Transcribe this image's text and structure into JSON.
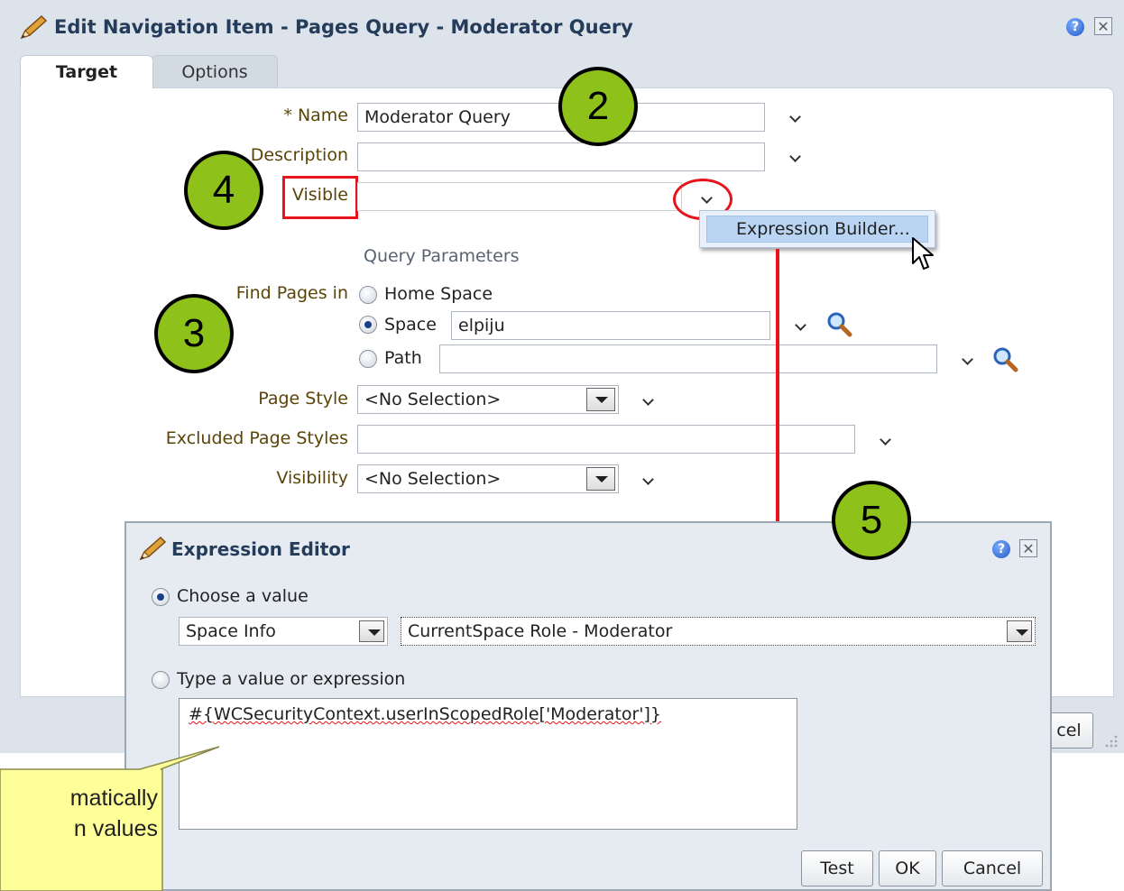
{
  "dialog": {
    "title": "Edit Navigation Item - Pages Query - Moderator Query",
    "help_icon": "?",
    "close_icon": "✕",
    "tabs": [
      {
        "label": "Target",
        "active": true
      },
      {
        "label": "Options",
        "active": false
      }
    ]
  },
  "form": {
    "name_label": "* Name",
    "name_value": "Moderator Query",
    "description_label": "Description",
    "description_value": "",
    "visible_label": "Visible",
    "visible_value": "",
    "query_params_heading": "Query Parameters",
    "find_pages_label": "Find Pages in",
    "radio_home": "Home Space",
    "radio_space": "Space",
    "space_value": "elpiju",
    "radio_path": "Path",
    "path_value": "",
    "page_style_label": "Page Style",
    "page_style_value": "<No Selection>",
    "excluded_label": "Excluded Page Styles",
    "excluded_value": "",
    "visibility_label": "Visibility",
    "visibility_value": "<No Selection>"
  },
  "dropdown_menu": {
    "item": "Expression Builder..."
  },
  "bottom_buttons": {
    "cancel_partial": "cel"
  },
  "callouts": {
    "two": "2",
    "three": "3",
    "four": "4",
    "five": "5"
  },
  "expression_editor": {
    "title": "Expression Editor",
    "choose_label": "Choose a value",
    "category_value": "Space Info",
    "value_select": "CurrentSpace Role - Moderator",
    "type_label": "Type a value or expression",
    "expression_text": "#{WCSecurityContext.userInScopedRole['Moderator']}",
    "test_button": "Test",
    "ok_button": "OK",
    "cancel_button": "Cancel"
  },
  "note": {
    "line1": "matically",
    "line2": "n values"
  },
  "colors": {
    "callout_fill": "#8ec21b",
    "highlight_red": "#e8141b",
    "note_fill": "#ffff99",
    "label_color": "#5a4408"
  },
  "icons": {
    "edit": "pencil-icon",
    "search": "magnifier-icon",
    "help": "help-icon",
    "close": "close-icon"
  }
}
